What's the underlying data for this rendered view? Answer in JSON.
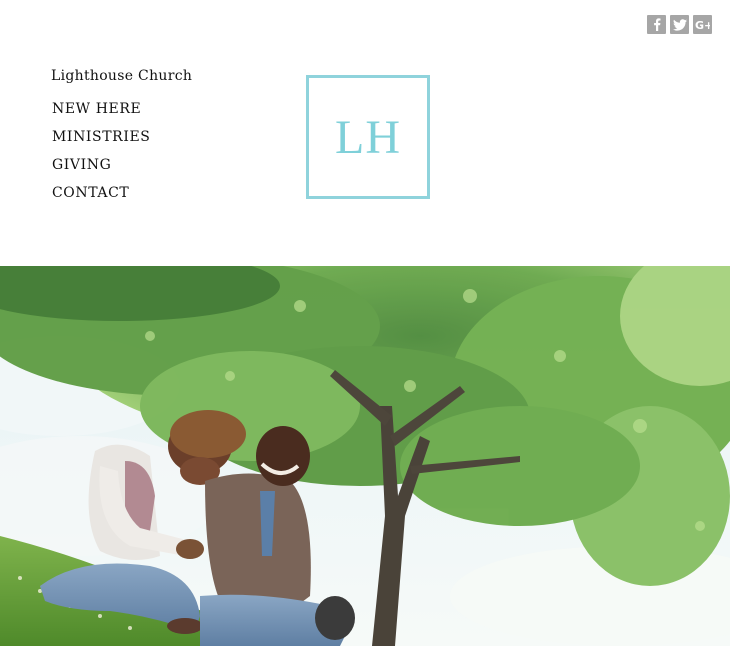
{
  "header": {
    "site_title": "Lighthouse Church",
    "logo_text": "LH",
    "logo_color": "#7fd0d9"
  },
  "nav": {
    "items": [
      {
        "label": "NEW HERE"
      },
      {
        "label": "MINISTRIES"
      },
      {
        "label": "GIVING"
      },
      {
        "label": "CONTACT"
      }
    ]
  },
  "social": {
    "icons": [
      "facebook-icon",
      "twitter-icon",
      "google-plus-icon"
    ],
    "color": "#a6a6a6"
  },
  "hero": {
    "image": "couple-sitting-on-grass-under-tree-photo"
  }
}
